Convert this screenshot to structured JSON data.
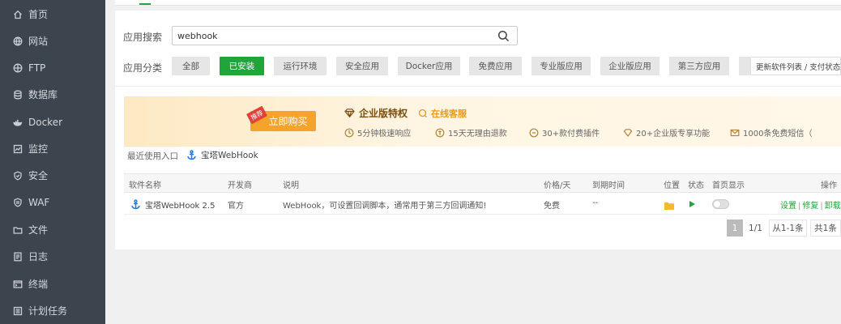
{
  "sidebar": {
    "items": [
      {
        "label": "首页",
        "icon": "home-icon"
      },
      {
        "label": "网站",
        "icon": "globe-icon"
      },
      {
        "label": "FTP",
        "icon": "ftp-globe-icon"
      },
      {
        "label": "数据库",
        "icon": "database-icon"
      },
      {
        "label": "Docker",
        "icon": "docker-icon"
      },
      {
        "label": "监控",
        "icon": "monitor-icon"
      },
      {
        "label": "安全",
        "icon": "shield-icon"
      },
      {
        "label": "WAF",
        "icon": "waf-shield-icon"
      },
      {
        "label": "文件",
        "icon": "folder-icon"
      },
      {
        "label": "日志",
        "icon": "log-icon"
      },
      {
        "label": "终端",
        "icon": "terminal-icon"
      },
      {
        "label": "计划任务",
        "icon": "task-icon"
      }
    ]
  },
  "search": {
    "label": "应用搜索",
    "value": "webhook"
  },
  "categories": {
    "label": "应用分类",
    "items": [
      "全部",
      "已安装",
      "运行环境",
      "安全应用",
      "Docker应用",
      "免费应用",
      "专业版应用",
      "企业版应用",
      "第三方应用"
    ],
    "active": "已安装",
    "update_button": "更新软件列表 / 支付状态"
  },
  "banner": {
    "badge": "推荐",
    "buy_button": "立即购买",
    "enterprise_title": "企业版特权",
    "customer_service": "在线客服",
    "features": [
      "5分钟极速响应",
      "15天无理由退款",
      "30+款付费插件",
      "20+企业版专享功能",
      "1000条免费短信（"
    ]
  },
  "recent": {
    "label": "最近使用入口",
    "app": "宝塔WebHook"
  },
  "table": {
    "headers": {
      "name": "软件名称",
      "developer": "开发商",
      "description": "说明",
      "price": "价格/天",
      "expire": "到期时间",
      "location": "位置",
      "status": "状态",
      "homepage": "首页显示",
      "ops": "操作"
    },
    "rows": [
      {
        "name": "宝塔WebHook 2.5",
        "developer": "官方",
        "description": "WebHook，可设置回调脚本，通常用于第三方回调通知!",
        "price": "免费",
        "expire": "--",
        "ops": [
          "设置",
          "修复",
          "卸载"
        ]
      }
    ]
  },
  "pagination": {
    "current": "1",
    "pages": "1/1",
    "range": "从1-1条",
    "total": "共1条"
  },
  "colors": {
    "sidebar_bg": "#3c444d",
    "accent_green": "#20a53a",
    "banner_orange": "#f6a32b"
  }
}
